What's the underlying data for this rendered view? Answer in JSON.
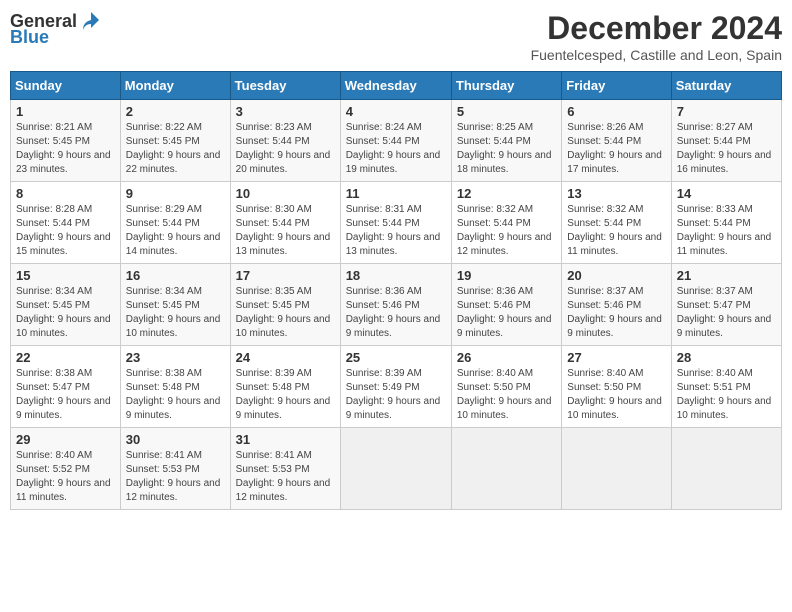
{
  "logo": {
    "general": "General",
    "blue": "Blue"
  },
  "title": "December 2024",
  "location": "Fuentelcesped, Castille and Leon, Spain",
  "headers": [
    "Sunday",
    "Monday",
    "Tuesday",
    "Wednesday",
    "Thursday",
    "Friday",
    "Saturday"
  ],
  "weeks": [
    [
      {
        "day": "1",
        "sunrise": "8:21 AM",
        "sunset": "5:45 PM",
        "daylight": "9 hours and 23 minutes."
      },
      {
        "day": "2",
        "sunrise": "8:22 AM",
        "sunset": "5:45 PM",
        "daylight": "9 hours and 22 minutes."
      },
      {
        "day": "3",
        "sunrise": "8:23 AM",
        "sunset": "5:44 PM",
        "daylight": "9 hours and 20 minutes."
      },
      {
        "day": "4",
        "sunrise": "8:24 AM",
        "sunset": "5:44 PM",
        "daylight": "9 hours and 19 minutes."
      },
      {
        "day": "5",
        "sunrise": "8:25 AM",
        "sunset": "5:44 PM",
        "daylight": "9 hours and 18 minutes."
      },
      {
        "day": "6",
        "sunrise": "8:26 AM",
        "sunset": "5:44 PM",
        "daylight": "9 hours and 17 minutes."
      },
      {
        "day": "7",
        "sunrise": "8:27 AM",
        "sunset": "5:44 PM",
        "daylight": "9 hours and 16 minutes."
      }
    ],
    [
      {
        "day": "8",
        "sunrise": "8:28 AM",
        "sunset": "5:44 PM",
        "daylight": "9 hours and 15 minutes."
      },
      {
        "day": "9",
        "sunrise": "8:29 AM",
        "sunset": "5:44 PM",
        "daylight": "9 hours and 14 minutes."
      },
      {
        "day": "10",
        "sunrise": "8:30 AM",
        "sunset": "5:44 PM",
        "daylight": "9 hours and 13 minutes."
      },
      {
        "day": "11",
        "sunrise": "8:31 AM",
        "sunset": "5:44 PM",
        "daylight": "9 hours and 13 minutes."
      },
      {
        "day": "12",
        "sunrise": "8:32 AM",
        "sunset": "5:44 PM",
        "daylight": "9 hours and 12 minutes."
      },
      {
        "day": "13",
        "sunrise": "8:32 AM",
        "sunset": "5:44 PM",
        "daylight": "9 hours and 11 minutes."
      },
      {
        "day": "14",
        "sunrise": "8:33 AM",
        "sunset": "5:44 PM",
        "daylight": "9 hours and 11 minutes."
      }
    ],
    [
      {
        "day": "15",
        "sunrise": "8:34 AM",
        "sunset": "5:45 PM",
        "daylight": "9 hours and 10 minutes."
      },
      {
        "day": "16",
        "sunrise": "8:34 AM",
        "sunset": "5:45 PM",
        "daylight": "9 hours and 10 minutes."
      },
      {
        "day": "17",
        "sunrise": "8:35 AM",
        "sunset": "5:45 PM",
        "daylight": "9 hours and 10 minutes."
      },
      {
        "day": "18",
        "sunrise": "8:36 AM",
        "sunset": "5:46 PM",
        "daylight": "9 hours and 9 minutes."
      },
      {
        "day": "19",
        "sunrise": "8:36 AM",
        "sunset": "5:46 PM",
        "daylight": "9 hours and 9 minutes."
      },
      {
        "day": "20",
        "sunrise": "8:37 AM",
        "sunset": "5:46 PM",
        "daylight": "9 hours and 9 minutes."
      },
      {
        "day": "21",
        "sunrise": "8:37 AM",
        "sunset": "5:47 PM",
        "daylight": "9 hours and 9 minutes."
      }
    ],
    [
      {
        "day": "22",
        "sunrise": "8:38 AM",
        "sunset": "5:47 PM",
        "daylight": "9 hours and 9 minutes."
      },
      {
        "day": "23",
        "sunrise": "8:38 AM",
        "sunset": "5:48 PM",
        "daylight": "9 hours and 9 minutes."
      },
      {
        "day": "24",
        "sunrise": "8:39 AM",
        "sunset": "5:48 PM",
        "daylight": "9 hours and 9 minutes."
      },
      {
        "day": "25",
        "sunrise": "8:39 AM",
        "sunset": "5:49 PM",
        "daylight": "9 hours and 9 minutes."
      },
      {
        "day": "26",
        "sunrise": "8:40 AM",
        "sunset": "5:50 PM",
        "daylight": "9 hours and 10 minutes."
      },
      {
        "day": "27",
        "sunrise": "8:40 AM",
        "sunset": "5:50 PM",
        "daylight": "9 hours and 10 minutes."
      },
      {
        "day": "28",
        "sunrise": "8:40 AM",
        "sunset": "5:51 PM",
        "daylight": "9 hours and 10 minutes."
      }
    ],
    [
      {
        "day": "29",
        "sunrise": "8:40 AM",
        "sunset": "5:52 PM",
        "daylight": "9 hours and 11 minutes."
      },
      {
        "day": "30",
        "sunrise": "8:41 AM",
        "sunset": "5:53 PM",
        "daylight": "9 hours and 12 minutes."
      },
      {
        "day": "31",
        "sunrise": "8:41 AM",
        "sunset": "5:53 PM",
        "daylight": "9 hours and 12 minutes."
      },
      null,
      null,
      null,
      null
    ]
  ],
  "labels": {
    "sunrise": "Sunrise:",
    "sunset": "Sunset:",
    "daylight": "Daylight:"
  }
}
